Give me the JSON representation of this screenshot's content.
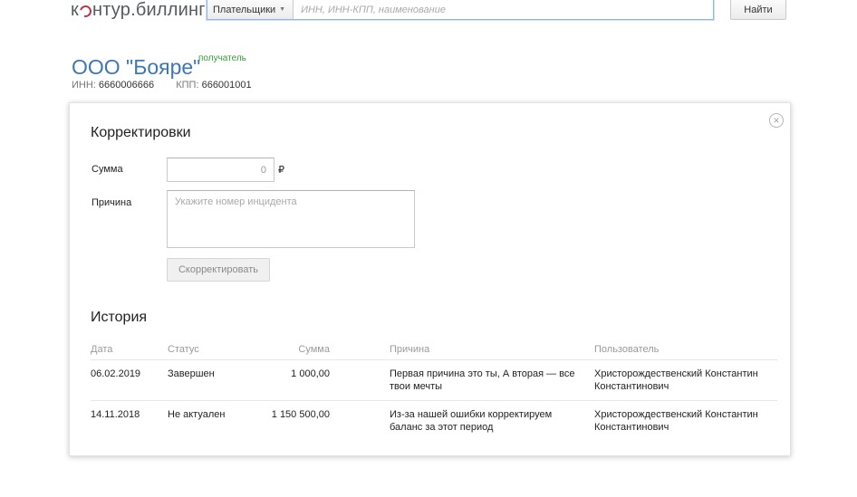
{
  "header": {
    "logo_prefix": "к",
    "logo_suffix": "нтур.биллинг",
    "search_scope": "Плательщики",
    "search_placeholder": "ИНН, ИНН-КПП, наименование",
    "find_label": "Найти"
  },
  "org": {
    "name": "ООО \"Бояре\"",
    "role": "получатель",
    "inn_label": "ИНН:",
    "inn": "6660006666",
    "kpp_label": "КПП:",
    "kpp": "666001001"
  },
  "corrections": {
    "title": "Корректировки",
    "amount_label": "Сумма",
    "amount_value": "0",
    "currency": "₽",
    "reason_label": "Причина",
    "reason_placeholder": "Укажите номер инцидента",
    "submit_label": "Скорректировать"
  },
  "history": {
    "title": "История",
    "columns": {
      "date": "Дата",
      "status": "Статус",
      "sum": "Сумма",
      "reason": "Причина",
      "user": "Пользователь"
    },
    "rows": [
      {
        "date": "06.02.2019",
        "status": "Завершен",
        "sum": "1 000,00",
        "reason": "Первая причина это ты, А вторая — все твои мечты",
        "user": "Христорождественский Константин Константинович"
      },
      {
        "date": "14.11.2018",
        "status": "Не актуален",
        "sum": "1 150 500,00",
        "reason": "Из-за нашей ошибки корректируем баланс за этот период",
        "user": "Христорождественский Константин Константинович"
      }
    ]
  },
  "colors": {
    "accent": "#3f76b5",
    "role_green": "#3a9a3a",
    "logo_red": "#b3344b"
  },
  "icons": {
    "close": "close-icon",
    "dropdown": "chevron-down-icon"
  }
}
